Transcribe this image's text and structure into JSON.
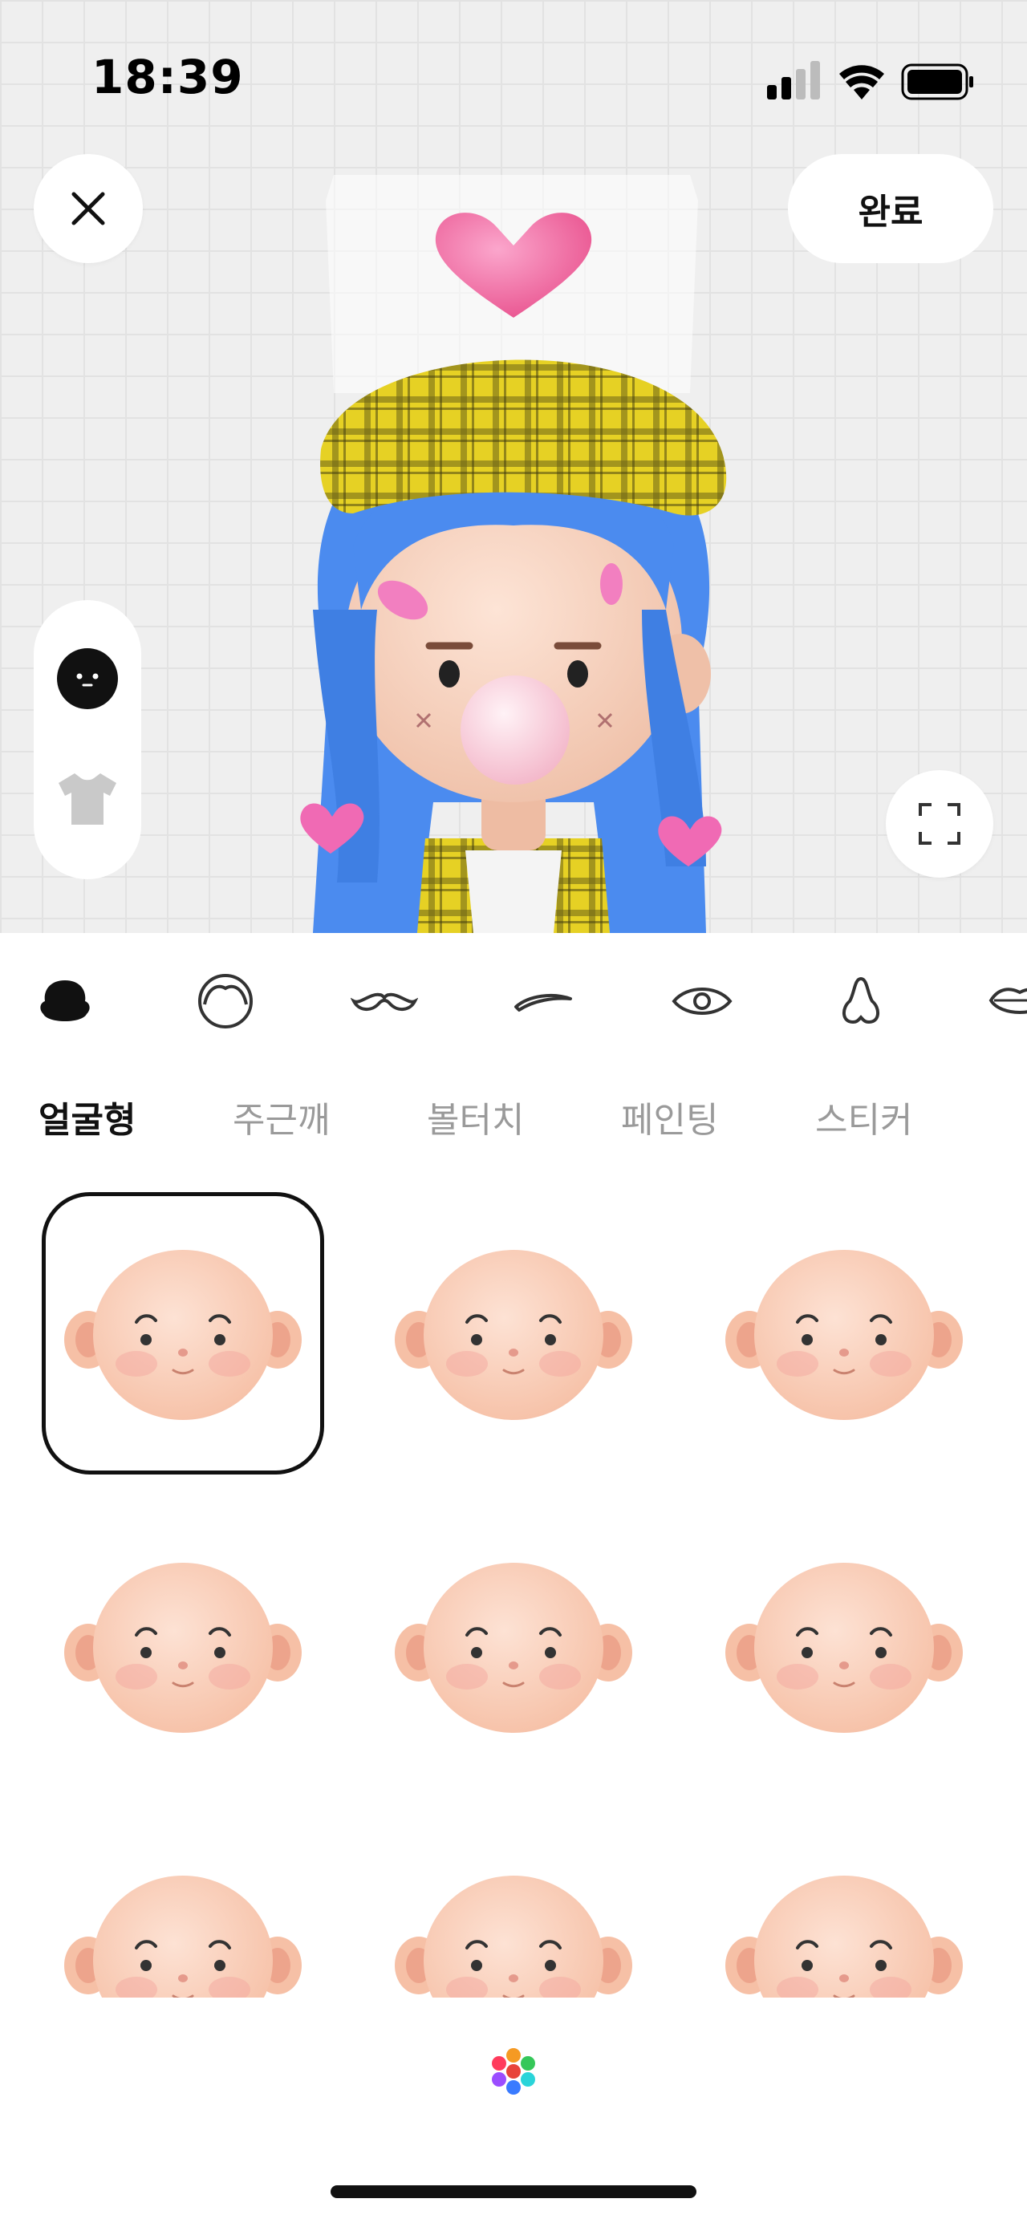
{
  "status_bar": {
    "time": "18:39"
  },
  "header": {
    "close_icon": "close-icon",
    "done_label": "완료"
  },
  "side_toolbar": {
    "items": [
      {
        "name": "face-mode",
        "icon": "face-icon",
        "selected": true
      },
      {
        "name": "clothes-mode",
        "icon": "tshirt-icon",
        "selected": false
      }
    ]
  },
  "fullscreen_icon": "fullscreen-icon",
  "categories": [
    {
      "icon": "face-shape-icon",
      "selected": true
    },
    {
      "icon": "hair-icon",
      "selected": false
    },
    {
      "icon": "mustache-icon",
      "selected": false
    },
    {
      "icon": "eyebrow-icon",
      "selected": false
    },
    {
      "icon": "eye-icon",
      "selected": false
    },
    {
      "icon": "nose-icon",
      "selected": false
    },
    {
      "icon": "lips-icon",
      "selected": false
    }
  ],
  "sub_tabs": [
    {
      "label": "얼굴형",
      "active": true
    },
    {
      "label": "주근깨",
      "active": false
    },
    {
      "label": "볼터치",
      "active": false
    },
    {
      "label": "페인팅",
      "active": false
    },
    {
      "label": "스티커",
      "active": false
    }
  ],
  "face_options": {
    "selected_index": 0,
    "count_visible": 9
  },
  "palette_icon": "color-palette-icon",
  "colors": {
    "skin": "#f6c0a6",
    "hair": "#4f8ef0",
    "hat": "#e8d22a",
    "heart": "#ef6fa6"
  }
}
